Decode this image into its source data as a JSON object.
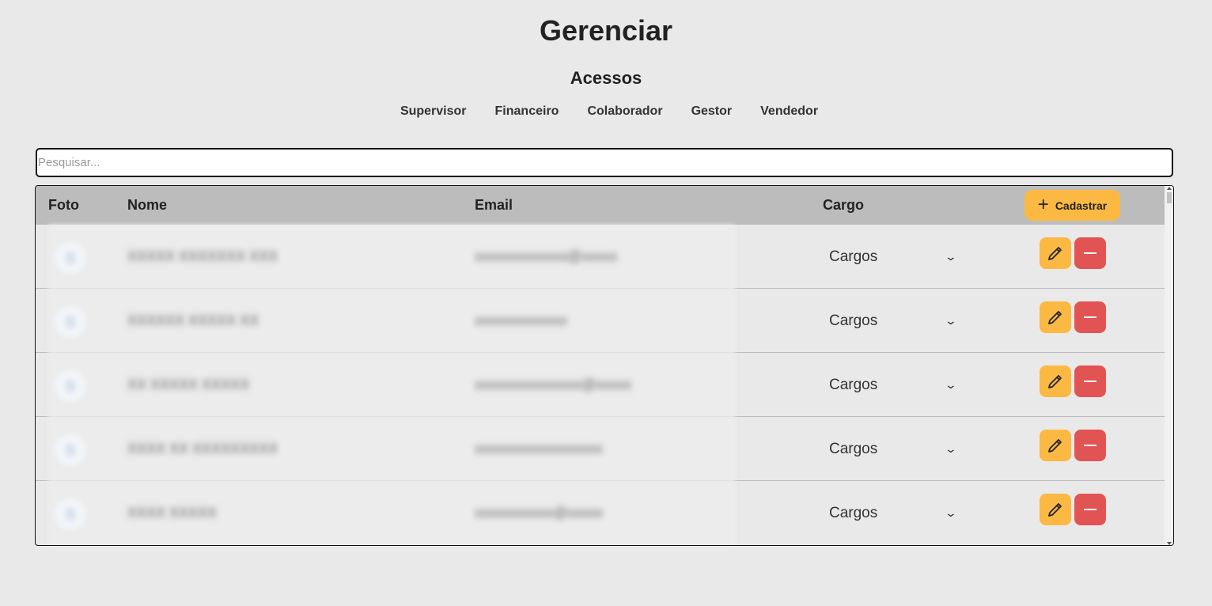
{
  "page": {
    "title": "Gerenciar"
  },
  "access": {
    "title": "Acessos",
    "roles": [
      "Supervisor",
      "Financeiro",
      "Colaborador",
      "Gestor",
      "Vendedor"
    ]
  },
  "search": {
    "placeholder": "Pesquisar...",
    "value": ""
  },
  "table": {
    "columns": {
      "photo": "Foto",
      "name": "Nome",
      "email": "Email",
      "role": "Cargo"
    },
    "add_button_label": "Cadastrar",
    "rows": [
      {
        "name": "XXXXX XXXXXXX XXX",
        "email": "xxxxxxxxxxxxx@xxxxx",
        "role": "Cargos"
      },
      {
        "name": "XXXXXX XXXXX XX",
        "email": "xxxxxxxxxxxxx",
        "role": "Cargos"
      },
      {
        "name": "XX XXXXX XXXXX",
        "email": "xxxxxxxxxxxxxxx@xxxxx",
        "role": "Cargos"
      },
      {
        "name": "XXXX XX XXXXXXXXX",
        "email": "xxxxxxxxxxxxxxxxxx",
        "role": "Cargos"
      },
      {
        "name": "XXXX XXXXX",
        "email": "xxxxxxxxxxx@xxxxx",
        "role": "Cargos"
      }
    ]
  },
  "colors": {
    "background": "#e9e9e9",
    "header": "#bcbcbc",
    "accent": "#fbb943",
    "danger": "#e25454"
  },
  "icons": {
    "add": "plus-icon",
    "edit": "pencil-icon",
    "delete": "minus-icon",
    "select": "chevron-down-icon"
  }
}
